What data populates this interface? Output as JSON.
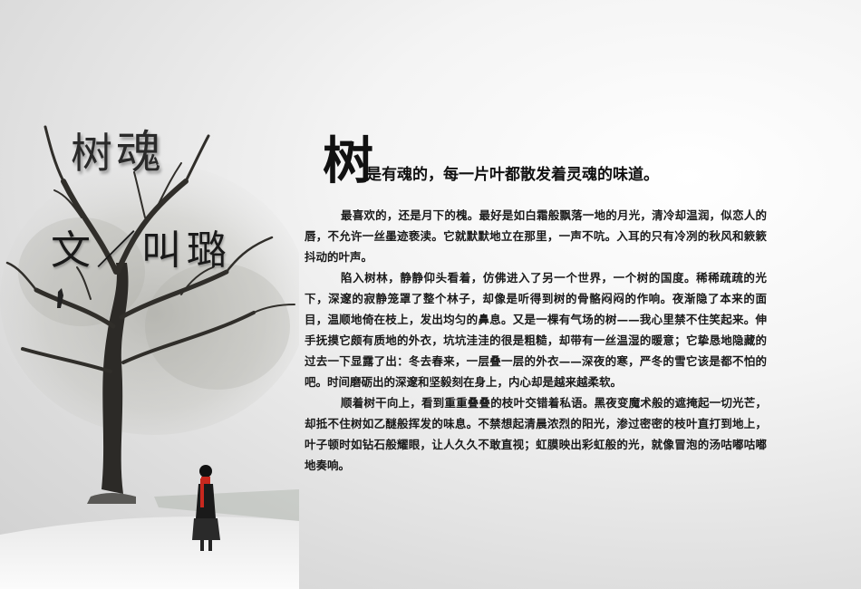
{
  "title": {
    "char1": "树",
    "char2": "魂"
  },
  "author": "文／叫璐",
  "lead": {
    "dropcap": "树",
    "text": "是有魂的，每一片叶都散发着灵魂的味道。"
  },
  "paragraphs": [
    "最喜欢的，还是月下的槐。最好是如白霜般飘落一地的月光，清冷却温润，似恋人的唇，不允许一丝墨迹亵渎。它就默默地立在那里，一声不吭。入耳的只有冷冽的秋风和簌簌抖动的叶声。",
    "陷入树林，静静仰头看着，仿佛进入了另一个世界，一个树的国度。稀稀疏疏的光下，深邃的寂静笼罩了整个林子，却像是听得到树的骨骼闷闷的作响。夜渐隐了本来的面目，温顺地倚在枝上，发出均匀的鼻息。又是一棵有气场的树——我心里禁不住笑起来。伸手抚摸它颇有质地的外衣，坑坑洼洼的很是粗糙，却带有一丝温湿的暖意；它挚恳地隐藏的过去一下显露了出：冬去春来，一层叠一层的外衣——深夜的寒，严冬的雪它该是都不怕的吧。时间磨砺出的深邃和坚毅刻在身上，内心却是越来越柔软。",
    "顺着树干向上，看到重重叠叠的枝叶交错着私语。黑夜变魔术般的遮掩起一切光芒，却抵不住树如乙醚般挥发的味息。不禁想起清晨浓烈的阳光，渗过密密的枝叶直打到地上，叶子顿时如钻石般耀眼，让人久久不敢直视；虹膜映出彩虹般的光，就像冒泡的汤咕嘟咕嘟地奏响。"
  ],
  "colors": {
    "scarf": "#c8281e",
    "ground": "#f6f6f6"
  }
}
